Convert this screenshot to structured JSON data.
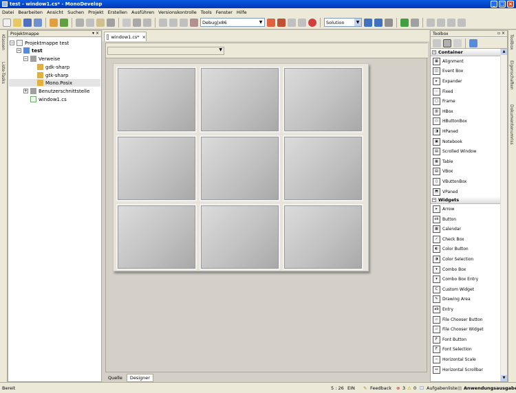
{
  "window": {
    "title": "test - window1.cs* - MonoDevelop"
  },
  "menu": [
    "Datei",
    "Bearbeiten",
    "Ansicht",
    "Suchen",
    "Projekt",
    "Erstellen",
    "Ausführen",
    "Versionskontrolle",
    "Tools",
    "Fenster",
    "Hilfe"
  ],
  "toolbar": {
    "config": "Debug|x86",
    "target": "Solution"
  },
  "left_tabs": [
    "Klassen",
    "Liste-Tasks"
  ],
  "solution": {
    "header": "Projektmappe",
    "root": "Projektmappe test",
    "project": "test",
    "references": "Verweise",
    "ref_items": [
      "gdk-sharp",
      "gtk-sharp",
      "Mono.Posix"
    ],
    "interfaces": "Benutzerschnittstelle",
    "file": "window1.cs"
  },
  "document": {
    "tab": "window1.cs*",
    "close": "×"
  },
  "bottom_tabs": {
    "source": "Quelle",
    "designer": "Designer"
  },
  "toolbox": {
    "header": "Toolbox",
    "categories": [
      {
        "name": "Container",
        "items": [
          "Alignment",
          "Event Box",
          "Expander",
          "Fixed",
          "Frame",
          "HBox",
          "HButtonBox",
          "HPaned",
          "Notebook",
          "Scrolled Window",
          "Table",
          "VBox",
          "VButtonBox",
          "VPaned"
        ]
      },
      {
        "name": "Widgets",
        "items": [
          "Arrow",
          "Button",
          "Calendar",
          "Check Box",
          "Color Button",
          "Color Selection",
          "Combo Box",
          "Combo Box Entry",
          "Custom Widget",
          "Drawing Area",
          "Entry",
          "File Chooser Button",
          "File Chooser Widget",
          "Font Button",
          "Font Selection",
          "Horizontal Scale",
          "Horizontal Scrollbar"
        ]
      }
    ]
  },
  "right_tabs": [
    "Toolbox",
    "Eigenschaften",
    "Dokumentenumriss"
  ],
  "status": {
    "ready": "Bereit",
    "position": "5 : 26",
    "mode": "EIN",
    "feedback": "Feedback",
    "errors": "3",
    "warnings": "0",
    "tasks": "Aufgabenliste",
    "output": "Anwendungsausgabe"
  }
}
